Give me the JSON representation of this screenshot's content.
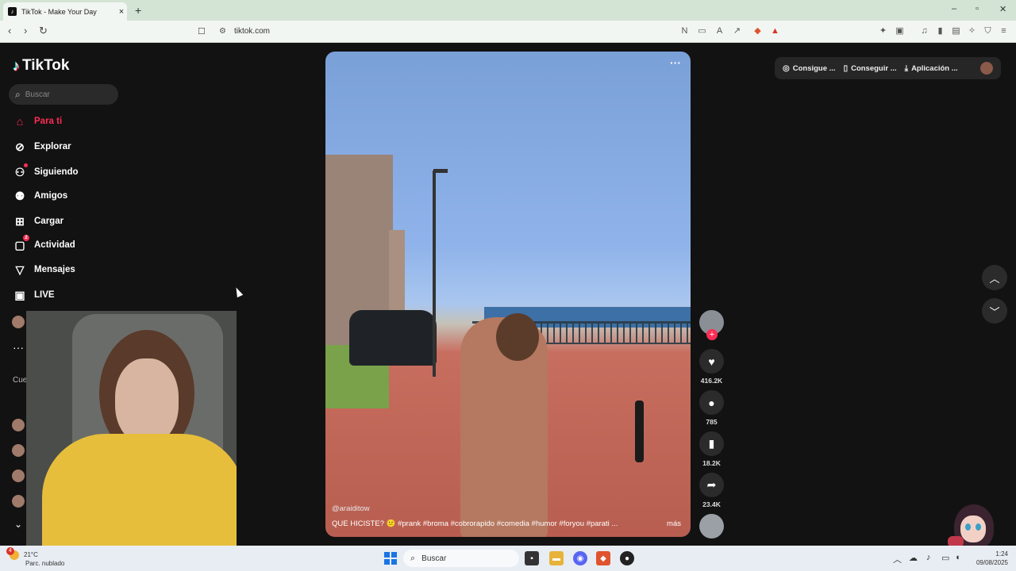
{
  "browser": {
    "tab_title": "TikTok - Make Your Day",
    "tab_close": "×",
    "new_tab": "+",
    "url": "tiktok.com"
  },
  "sidebar": {
    "logo": "TikTok",
    "search_placeholder": "Buscar",
    "items": [
      {
        "label": "Para ti",
        "icon": "home-icon",
        "active": true
      },
      {
        "label": "Explorar",
        "icon": "compass-icon"
      },
      {
        "label": "Siguiendo",
        "icon": "following-icon"
      },
      {
        "label": "Amigos",
        "icon": "friends-icon"
      },
      {
        "label": "Cargar",
        "icon": "upload-icon"
      },
      {
        "label": "Actividad",
        "icon": "activity-icon",
        "badge": "2"
      },
      {
        "label": "Mensajes",
        "icon": "messages-icon"
      },
      {
        "label": "LIVE",
        "icon": "live-icon"
      }
    ],
    "accounts_label": "Cue",
    "more": "···"
  },
  "video": {
    "username": "@araiditow",
    "caption": "QUE HICISTE? 😕 #prank #broma #cobrorapido #comedia #humor #foryou #parati ...",
    "more_label": "más"
  },
  "actions": {
    "likes": "416.2K",
    "comments": "785",
    "saves": "18.2K",
    "shares": "23.4K"
  },
  "topbar": {
    "coins": "Consigue ...",
    "get_app": "Conseguir ...",
    "app": "Aplicación ..."
  },
  "taskbar": {
    "weather_temp": "21°C",
    "weather_desc": "Parc. nublado",
    "weather_badge": "4",
    "search": "Buscar",
    "time": "1:24",
    "date": "09/08/2025"
  },
  "colors": {
    "accent": "#fe2c55",
    "background": "#121212"
  }
}
